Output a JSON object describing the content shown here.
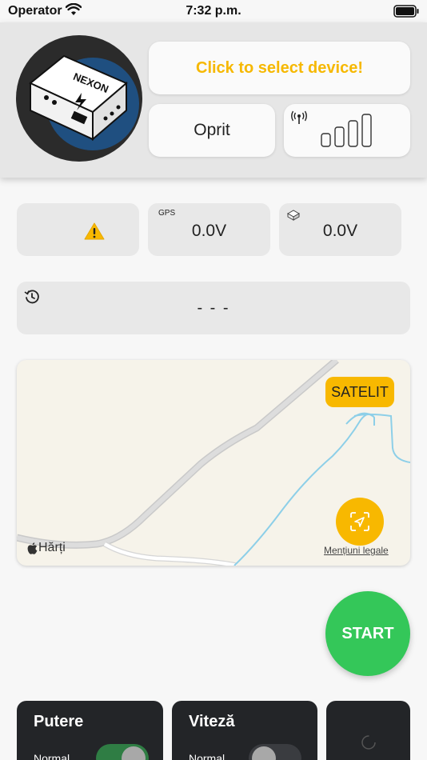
{
  "status_bar": {
    "carrier": "Operator",
    "time": "7:32 p.m."
  },
  "header": {
    "device_logo_text": "NEXON",
    "select_device_label": "Click to select device!",
    "device_status": "Oprit",
    "signal_level": 0.0
  },
  "tiles": {
    "gps_label": "GPS",
    "gps_value": "0.0V",
    "battery_value": "0.0V",
    "history_value": "- - -"
  },
  "map": {
    "satellite_label": "SATELIT",
    "maps_label": "Hărți",
    "legal_label": "Mențiuni legale"
  },
  "start_label": "START",
  "controls": {
    "power": {
      "title": "Putere",
      "sub": "Normal",
      "enabled": true
    },
    "speed": {
      "title": "Viteză",
      "sub": "Normal",
      "enabled": false
    }
  },
  "colors": {
    "accent": "#f8b800",
    "start_green": "#34c759",
    "dark_card": "#232528",
    "toggle_on": "#2f7d44"
  },
  "icons": [
    "wifi-icon",
    "battery-icon",
    "antenna-icon",
    "signal-bars-icon",
    "warning-icon",
    "battery-small-icon",
    "history-icon",
    "locate-icon",
    "apple-logo-icon",
    "spinner-icon"
  ]
}
